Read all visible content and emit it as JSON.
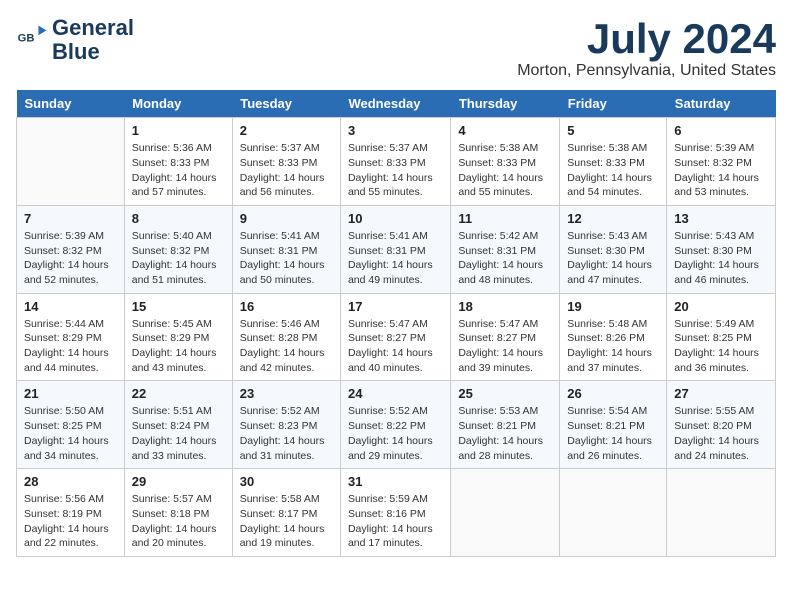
{
  "header": {
    "logo_line1": "General",
    "logo_line2": "Blue",
    "month": "July 2024",
    "location": "Morton, Pennsylvania, United States"
  },
  "weekdays": [
    "Sunday",
    "Monday",
    "Tuesday",
    "Wednesday",
    "Thursday",
    "Friday",
    "Saturday"
  ],
  "weeks": [
    [
      {
        "day": "",
        "empty": true
      },
      {
        "day": "1",
        "sunrise": "5:36 AM",
        "sunset": "8:33 PM",
        "daylight": "14 hours and 57 minutes."
      },
      {
        "day": "2",
        "sunrise": "5:37 AM",
        "sunset": "8:33 PM",
        "daylight": "14 hours and 56 minutes."
      },
      {
        "day": "3",
        "sunrise": "5:37 AM",
        "sunset": "8:33 PM",
        "daylight": "14 hours and 55 minutes."
      },
      {
        "day": "4",
        "sunrise": "5:38 AM",
        "sunset": "8:33 PM",
        "daylight": "14 hours and 55 minutes."
      },
      {
        "day": "5",
        "sunrise": "5:38 AM",
        "sunset": "8:33 PM",
        "daylight": "14 hours and 54 minutes."
      },
      {
        "day": "6",
        "sunrise": "5:39 AM",
        "sunset": "8:32 PM",
        "daylight": "14 hours and 53 minutes."
      }
    ],
    [
      {
        "day": "7",
        "sunrise": "5:39 AM",
        "sunset": "8:32 PM",
        "daylight": "14 hours and 52 minutes."
      },
      {
        "day": "8",
        "sunrise": "5:40 AM",
        "sunset": "8:32 PM",
        "daylight": "14 hours and 51 minutes."
      },
      {
        "day": "9",
        "sunrise": "5:41 AM",
        "sunset": "8:31 PM",
        "daylight": "14 hours and 50 minutes."
      },
      {
        "day": "10",
        "sunrise": "5:41 AM",
        "sunset": "8:31 PM",
        "daylight": "14 hours and 49 minutes."
      },
      {
        "day": "11",
        "sunrise": "5:42 AM",
        "sunset": "8:31 PM",
        "daylight": "14 hours and 48 minutes."
      },
      {
        "day": "12",
        "sunrise": "5:43 AM",
        "sunset": "8:30 PM",
        "daylight": "14 hours and 47 minutes."
      },
      {
        "day": "13",
        "sunrise": "5:43 AM",
        "sunset": "8:30 PM",
        "daylight": "14 hours and 46 minutes."
      }
    ],
    [
      {
        "day": "14",
        "sunrise": "5:44 AM",
        "sunset": "8:29 PM",
        "daylight": "14 hours and 44 minutes."
      },
      {
        "day": "15",
        "sunrise": "5:45 AM",
        "sunset": "8:29 PM",
        "daylight": "14 hours and 43 minutes."
      },
      {
        "day": "16",
        "sunrise": "5:46 AM",
        "sunset": "8:28 PM",
        "daylight": "14 hours and 42 minutes."
      },
      {
        "day": "17",
        "sunrise": "5:47 AM",
        "sunset": "8:27 PM",
        "daylight": "14 hours and 40 minutes."
      },
      {
        "day": "18",
        "sunrise": "5:47 AM",
        "sunset": "8:27 PM",
        "daylight": "14 hours and 39 minutes."
      },
      {
        "day": "19",
        "sunrise": "5:48 AM",
        "sunset": "8:26 PM",
        "daylight": "14 hours and 37 minutes."
      },
      {
        "day": "20",
        "sunrise": "5:49 AM",
        "sunset": "8:25 PM",
        "daylight": "14 hours and 36 minutes."
      }
    ],
    [
      {
        "day": "21",
        "sunrise": "5:50 AM",
        "sunset": "8:25 PM",
        "daylight": "14 hours and 34 minutes."
      },
      {
        "day": "22",
        "sunrise": "5:51 AM",
        "sunset": "8:24 PM",
        "daylight": "14 hours and 33 minutes."
      },
      {
        "day": "23",
        "sunrise": "5:52 AM",
        "sunset": "8:23 PM",
        "daylight": "14 hours and 31 minutes."
      },
      {
        "day": "24",
        "sunrise": "5:52 AM",
        "sunset": "8:22 PM",
        "daylight": "14 hours and 29 minutes."
      },
      {
        "day": "25",
        "sunrise": "5:53 AM",
        "sunset": "8:21 PM",
        "daylight": "14 hours and 28 minutes."
      },
      {
        "day": "26",
        "sunrise": "5:54 AM",
        "sunset": "8:21 PM",
        "daylight": "14 hours and 26 minutes."
      },
      {
        "day": "27",
        "sunrise": "5:55 AM",
        "sunset": "8:20 PM",
        "daylight": "14 hours and 24 minutes."
      }
    ],
    [
      {
        "day": "28",
        "sunrise": "5:56 AM",
        "sunset": "8:19 PM",
        "daylight": "14 hours and 22 minutes."
      },
      {
        "day": "29",
        "sunrise": "5:57 AM",
        "sunset": "8:18 PM",
        "daylight": "14 hours and 20 minutes."
      },
      {
        "day": "30",
        "sunrise": "5:58 AM",
        "sunset": "8:17 PM",
        "daylight": "14 hours and 19 minutes."
      },
      {
        "day": "31",
        "sunrise": "5:59 AM",
        "sunset": "8:16 PM",
        "daylight": "14 hours and 17 minutes."
      },
      {
        "day": "",
        "empty": true
      },
      {
        "day": "",
        "empty": true
      },
      {
        "day": "",
        "empty": true
      }
    ]
  ]
}
